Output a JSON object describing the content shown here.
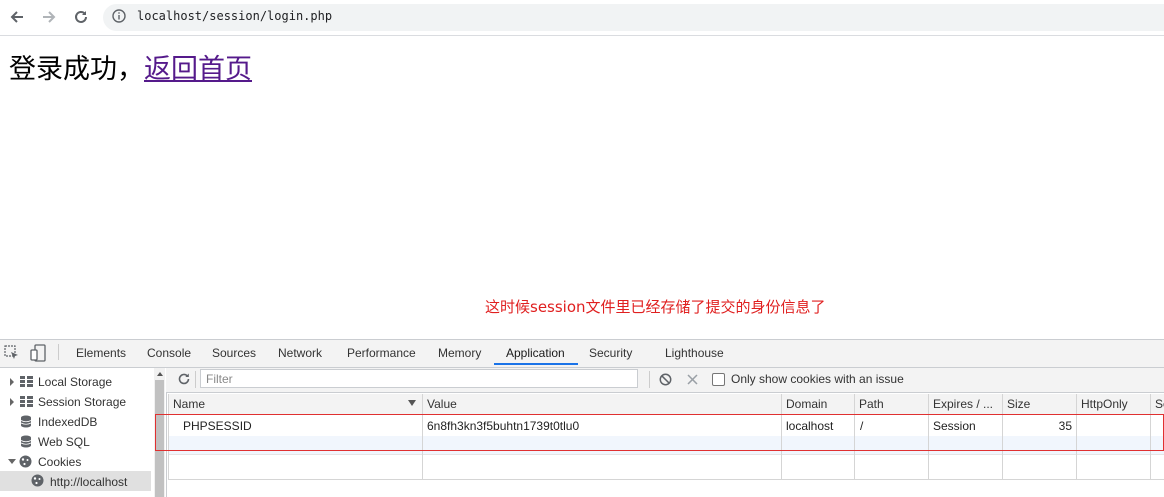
{
  "browser": {
    "url": "localhost/session/login.php"
  },
  "page": {
    "message": "登录成功，",
    "link": "返回首页",
    "annotation": "这时候session文件里已经存储了提交的身份信息了"
  },
  "devtools": {
    "tabs": [
      "Elements",
      "Console",
      "Sources",
      "Network",
      "Performance",
      "Memory",
      "Application",
      "Security",
      "Lighthouse"
    ],
    "active_tab": "Application",
    "sidebar": {
      "items": [
        "Local Storage",
        "Session Storage",
        "IndexedDB",
        "Web SQL",
        "Cookies",
        "http://localhost"
      ]
    },
    "filter": {
      "placeholder": "Filter",
      "only_issue_label": "Only show cookies with an issue"
    },
    "table": {
      "columns": [
        "Name",
        "Value",
        "Domain",
        "Path",
        "Expires / ...",
        "Size",
        "HttpOnly",
        "Se"
      ],
      "rows": [
        {
          "name": "PHPSESSID",
          "value": "6n8fh3kn3f5buhtn1739t0tlu0",
          "domain": "localhost",
          "path": "/",
          "expires": "Session",
          "size": "35",
          "httponly": ""
        }
      ]
    }
  },
  "colors": {
    "link": "#551a8b",
    "annotation": "#e02020",
    "accent": "#1a73e8"
  }
}
